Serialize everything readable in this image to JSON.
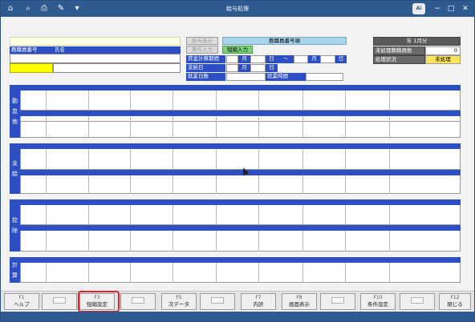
{
  "window": {
    "title": "給与処理"
  },
  "toolbar": {
    "icons": [
      "home-icon",
      "search-icon",
      "print-icon",
      "calculator-icon",
      "dropdown-icon"
    ],
    "logo": "Ai"
  },
  "employee": {
    "number_label": "教職員番号",
    "name_label": "氏名",
    "number_value": "",
    "name_value": ""
  },
  "middle": {
    "btn1": "給与表示",
    "btn2": "賞与入力",
    "order_label": "教職員番号順",
    "mode_badge": "短縮入力",
    "period_label": "賃金計算期間",
    "month": "月",
    "day": "日",
    "tilde": "〜",
    "pay_label": "支給日",
    "workdays_label": "就業日数",
    "workhours_label": "就業時間"
  },
  "right_panel": {
    "header": "年  1月分",
    "unprocessed_label": "未処理教職員数",
    "unprocessed_value": "0",
    "status_label": "処理状況",
    "status_value": "未処理"
  },
  "sections": [
    {
      "name": "勤怠他",
      "chars": [
        "勤",
        "怠",
        "他"
      ]
    },
    {
      "name": "支給",
      "chars": [
        "支",
        "給"
      ]
    },
    {
      "name": "控除",
      "chars": [
        "控",
        "除"
      ]
    },
    {
      "name": "計算",
      "chars": [
        "計",
        "算"
      ]
    }
  ],
  "fkeys": [
    {
      "key": "F1",
      "label": "ヘルプ"
    },
    {
      "key": "",
      "label": ""
    },
    {
      "key": "F3",
      "label": "短縮設定"
    },
    {
      "key": "",
      "label": ""
    },
    {
      "key": "F5",
      "label": "次データ"
    },
    {
      "key": "",
      "label": ""
    },
    {
      "key": "F7",
      "label": "内訳"
    },
    {
      "key": "F8",
      "label": "画面表示"
    },
    {
      "key": "",
      "label": ""
    },
    {
      "key": "F10",
      "label": "条件設定"
    },
    {
      "key": "",
      "label": ""
    },
    {
      "key": "F12",
      "label": "閉じる"
    }
  ],
  "colors": {
    "accent": "#2e4fc3",
    "title": "#2f5a8f",
    "highlight": "#e0202a",
    "warning": "#ffff00"
  }
}
